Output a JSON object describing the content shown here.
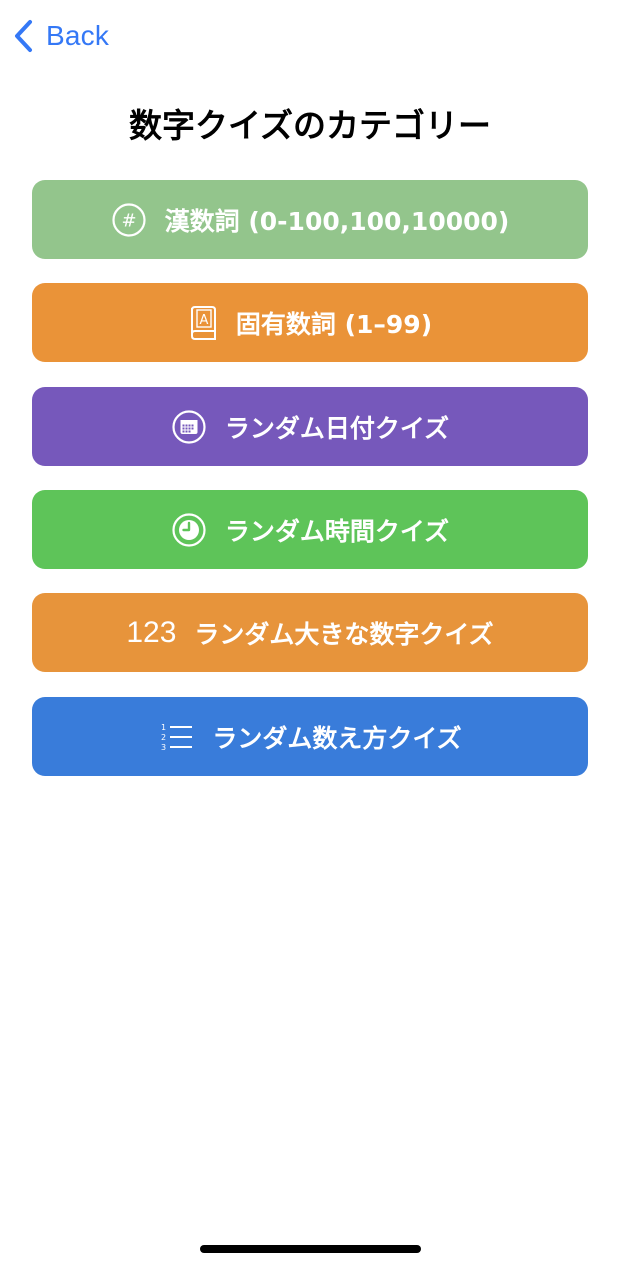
{
  "nav": {
    "back_label": "Back"
  },
  "page": {
    "title": "数字クイズのカテゴリー"
  },
  "categories": [
    {
      "label": "漢数詞 (0-100,100,10000)",
      "icon": "hashtag-circle-icon",
      "color": "#93c58c"
    },
    {
      "label": "固有数詞 (1–99)",
      "icon": "book-icon",
      "color": "#ea9338"
    },
    {
      "label": "ランダム日付クイズ",
      "icon": "calendar-circle-icon",
      "color": "#7658bb"
    },
    {
      "label": "ランダム時間クイズ",
      "icon": "clock-circle-icon",
      "color": "#5ec459"
    },
    {
      "label": "ランダム大きな数字クイズ",
      "icon": "numbers-icon",
      "icon_text": "123",
      "color": "#e7943b"
    },
    {
      "label": "ランダム数え方クイズ",
      "icon": "numbered-list-icon",
      "color": "#397cda"
    }
  ],
  "colors": {
    "accent": "#3478f6"
  }
}
